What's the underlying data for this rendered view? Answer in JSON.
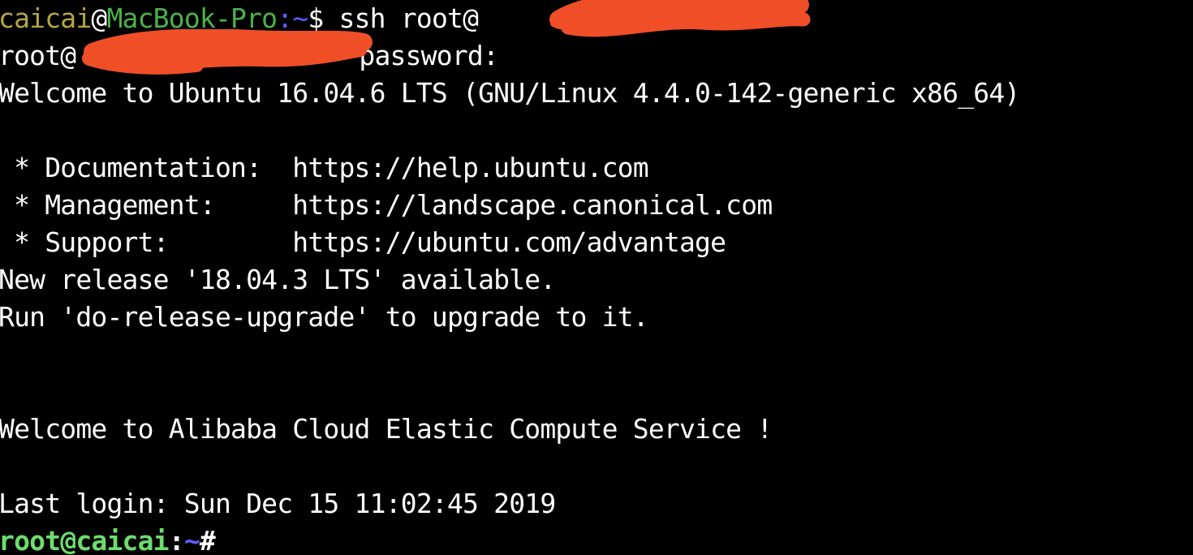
{
  "terminal": {
    "background_color": "#000000",
    "default_text_color": "#ffffff",
    "colors": {
      "local_user": "#b5a642",
      "local_host": "#4bb24b",
      "prompt_punct": "#5c5cff",
      "remote_prompt": "#6ddc6d",
      "redaction": "#ef4e27"
    },
    "lines": {
      "l1_user": "caicai",
      "l1_at": "@",
      "l1_host": "MacBook-Pro",
      "l1_colon": ":",
      "l1_tilde": "~",
      "l1_dollar": "$",
      "l1_command": " ssh root@",
      "l2_prefix": "root@",
      "l2_password": " password:",
      "l3": "Welcome to Ubuntu 16.04.6 LTS (GNU/Linux 4.4.0-142-generic x86_64)",
      "l5": " * Documentation:  https://help.ubuntu.com",
      "l6": " * Management:     https://landscape.canonical.com",
      "l7": " * Support:        https://ubuntu.com/advantage",
      "l8": "New release '18.04.3 LTS' available.",
      "l9": "Run 'do-release-upgrade' to upgrade to it.",
      "l12": "Welcome to Alibaba Cloud Elastic Compute Service !",
      "l14": "Last login: Sun Dec 15 11:02:45 2019",
      "l15_user": "root@caicai",
      "l15_colon": ":",
      "l15_tilde": "~",
      "l15_hash": "#"
    }
  }
}
